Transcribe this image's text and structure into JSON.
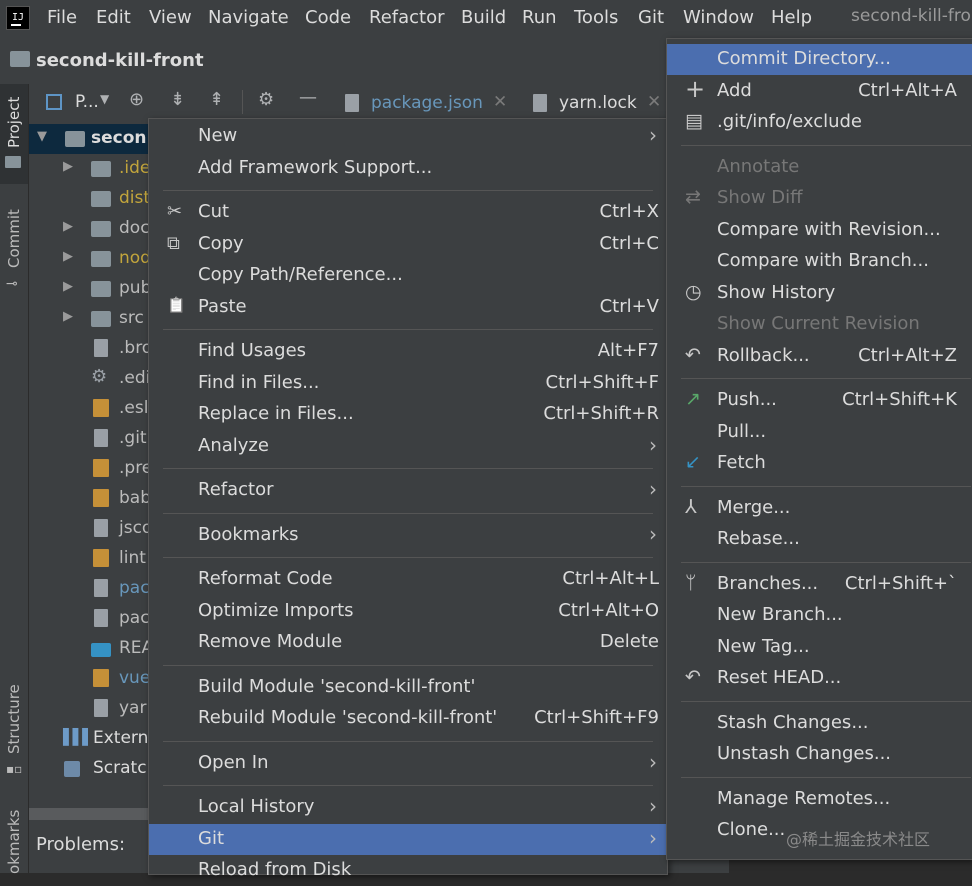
{
  "app": {
    "window_title": "second-kill-fro"
  },
  "menubar": [
    "File",
    "Edit",
    "View",
    "Navigate",
    "Code",
    "Refactor",
    "Build",
    "Run",
    "Tools",
    "Git",
    "Window",
    "Help"
  ],
  "navbar": {
    "project": "second-kill-front"
  },
  "toolstrip": {
    "project": "Project",
    "commit": "Commit",
    "structure": "Structure",
    "bookmarks": "okmarks"
  },
  "project_panel": {
    "dropdown": "P...",
    "tree": [
      {
        "label": "secon",
        "type": "folder",
        "expanded": true,
        "color": "#dcdcdc"
      },
      {
        "label": ".ide",
        "type": "folder",
        "color": "#c2a53c"
      },
      {
        "label": "dist",
        "type": "folder",
        "color": "#c2a53c"
      },
      {
        "label": "doc",
        "type": "folder",
        "color": "#bbbbbb"
      },
      {
        "label": "nod",
        "type": "folder",
        "color": "#c2a53c"
      },
      {
        "label": "pub",
        "type": "folder",
        "color": "#bbbbbb"
      },
      {
        "label": "src",
        "type": "folder",
        "color": "#bbbbbb"
      },
      {
        "label": ".bro",
        "type": "file",
        "color": "#bbbbbb"
      },
      {
        "label": ".edi",
        "type": "gear",
        "color": "#bbbbbb"
      },
      {
        "label": ".esl",
        "type": "js",
        "color": "#bbbbbb"
      },
      {
        "label": ".git",
        "type": "file",
        "color": "#bbbbbb"
      },
      {
        "label": ".pre",
        "type": "js",
        "color": "#bbbbbb"
      },
      {
        "label": "bab",
        "type": "js",
        "color": "#bbbbbb"
      },
      {
        "label": "jsco",
        "type": "file",
        "color": "#bbbbbb"
      },
      {
        "label": "lint",
        "type": "js",
        "color": "#bbbbbb"
      },
      {
        "label": "pac",
        "type": "file",
        "color": "#6897bb"
      },
      {
        "label": "pac",
        "type": "file",
        "color": "#bbbbbb"
      },
      {
        "label": "REA",
        "type": "md",
        "color": "#bbbbbb"
      },
      {
        "label": "vue",
        "type": "js",
        "color": "#6897bb"
      },
      {
        "label": "yar",
        "type": "file",
        "color": "#bbbbbb"
      }
    ],
    "external": "Extern",
    "scratches": "Scratch"
  },
  "tabs": [
    {
      "label": "package.json",
      "color": "#6897bb"
    },
    {
      "label": "yarn.lock",
      "color": "#bbbbbb"
    }
  ],
  "problems": "Problems:",
  "context_menu": {
    "items": [
      {
        "label": "New",
        "submenu": true
      },
      {
        "label": "Add Framework Support..."
      },
      {
        "sep": true
      },
      {
        "label": "Cut",
        "shortcut": "Ctrl+X",
        "icon": "scissors-icon"
      },
      {
        "label": "Copy",
        "shortcut": "Ctrl+C",
        "icon": "copy-icon"
      },
      {
        "label": "Copy Path/Reference..."
      },
      {
        "label": "Paste",
        "shortcut": "Ctrl+V",
        "icon": "paste-icon"
      },
      {
        "sep": true
      },
      {
        "label": "Find Usages",
        "shortcut": "Alt+F7"
      },
      {
        "label": "Find in Files...",
        "shortcut": "Ctrl+Shift+F"
      },
      {
        "label": "Replace in Files...",
        "shortcut": "Ctrl+Shift+R"
      },
      {
        "label": "Analyze",
        "submenu": true
      },
      {
        "sep": true
      },
      {
        "label": "Refactor",
        "submenu": true
      },
      {
        "sep": true
      },
      {
        "label": "Bookmarks",
        "submenu": true
      },
      {
        "sep": true
      },
      {
        "label": "Reformat Code",
        "shortcut": "Ctrl+Alt+L"
      },
      {
        "label": "Optimize Imports",
        "shortcut": "Ctrl+Alt+O"
      },
      {
        "label": "Remove Module",
        "shortcut": "Delete"
      },
      {
        "sep": true
      },
      {
        "label": "Build Module 'second-kill-front'"
      },
      {
        "label": "Rebuild Module 'second-kill-front'",
        "shortcut": "Ctrl+Shift+F9"
      },
      {
        "sep": true
      },
      {
        "label": "Open In",
        "submenu": true
      },
      {
        "sep": true
      },
      {
        "label": "Local History",
        "submenu": true
      },
      {
        "label": "Git",
        "submenu": true,
        "selected": true
      },
      {
        "label": "Reload from Disk"
      }
    ]
  },
  "git_menu": {
    "items": [
      {
        "label": "Commit Directory...",
        "selected": true
      },
      {
        "label": "Add",
        "shortcut": "Ctrl+Alt+A",
        "icon": "plus-icon"
      },
      {
        "label": ".git/info/exclude",
        "icon": "git-file-icon"
      },
      {
        "sep": true
      },
      {
        "label": "Annotate",
        "disabled": true
      },
      {
        "label": "Show Diff",
        "disabled": true,
        "icon": "diff-icon"
      },
      {
        "label": "Compare with Revision..."
      },
      {
        "label": "Compare with Branch..."
      },
      {
        "label": "Show History",
        "icon": "history-icon"
      },
      {
        "label": "Show Current Revision",
        "disabled": true
      },
      {
        "label": "Rollback...",
        "shortcut": "Ctrl+Alt+Z",
        "icon": "rollback-icon"
      },
      {
        "sep": true
      },
      {
        "label": "Push...",
        "shortcut": "Ctrl+Shift+K",
        "icon": "push-icon"
      },
      {
        "label": "Pull..."
      },
      {
        "label": "Fetch",
        "icon": "fetch-icon"
      },
      {
        "sep": true
      },
      {
        "label": "Merge...",
        "icon": "merge-icon"
      },
      {
        "label": "Rebase..."
      },
      {
        "sep": true
      },
      {
        "label": "Branches...",
        "shortcut": "Ctrl+Shift+`",
        "icon": "branch-icon"
      },
      {
        "label": "New Branch..."
      },
      {
        "label": "New Tag..."
      },
      {
        "label": "Reset HEAD...",
        "icon": "reset-icon"
      },
      {
        "sep": true
      },
      {
        "label": "Stash Changes..."
      },
      {
        "label": "Unstash Changes..."
      },
      {
        "sep": true
      },
      {
        "label": "Manage Remotes..."
      },
      {
        "label": "Clone..."
      }
    ]
  },
  "watermark": "@稀土掘金技术社区"
}
